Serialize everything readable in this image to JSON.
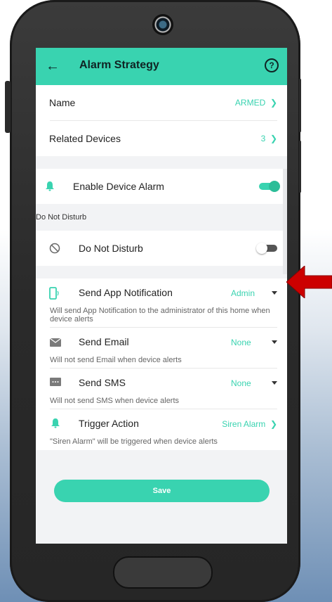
{
  "header": {
    "title": "Alarm Strategy",
    "back_icon": "arrow-left-icon",
    "help_icon": "question-circle-icon"
  },
  "rows": {
    "name_label": "Name",
    "name_value": "ARMED",
    "related_label": "Related Devices",
    "related_value": "3"
  },
  "alarm": {
    "enable_label": "Enable Device Alarm",
    "enable_state": "on"
  },
  "dnd": {
    "section_label": "Do Not Disturb",
    "label": "Do Not Disturb",
    "state": "off"
  },
  "notifications": [
    {
      "label": "Send App Notification",
      "value": "Admin",
      "desc": "Will send App Notification to the administrator of this home when device alerts",
      "icon": "phone-icon"
    },
    {
      "label": "Send Email",
      "value": "None",
      "desc": "Will not send Email when device alerts",
      "icon": "envelope-icon"
    },
    {
      "label": "Send SMS",
      "value": "None",
      "desc": "Will not send SMS when device alerts",
      "icon": "sms-icon"
    },
    {
      "label": "Trigger Action",
      "value": "Siren Alarm",
      "desc": "\"Siren Alarm\" will be triggered when device alerts",
      "icon": "bell-icon"
    }
  ],
  "save_label": "Save",
  "colors": {
    "accent": "#39d3b0",
    "arrow": "#cc0000"
  }
}
